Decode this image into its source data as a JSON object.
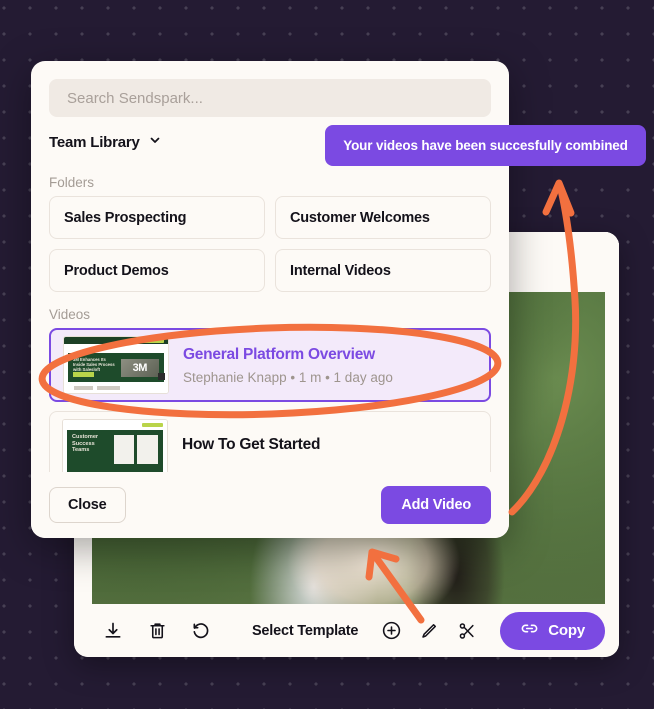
{
  "theme": {
    "background": "#241B33",
    "panel": "#FDFAF6",
    "accent_purple": "#7B4AE2",
    "selected_row_bg": "#F3EAFA",
    "annotation_orange": "#F2703F",
    "muted_text": "#A49C95",
    "primary_text": "#14121A"
  },
  "toast": {
    "message": "Your videos have been succesfully combined"
  },
  "modal": {
    "search": {
      "placeholder": "Search Sendspark...",
      "value": ""
    },
    "library_selector": {
      "label": "Team Library",
      "icon": "chevron-down-icon"
    },
    "folders_label": "Folders",
    "folders": [
      {
        "label": "Sales Prospecting"
      },
      {
        "label": "Customer Welcomes"
      },
      {
        "label": "Product Demos"
      },
      {
        "label": "Internal Videos"
      }
    ],
    "videos_label": "Videos",
    "videos": [
      {
        "title": "General Platform Overview",
        "meta": "Stephanie Knapp • 1 m • 1 day ago",
        "author": "Stephanie Knapp",
        "duration": "1 m",
        "age": "1 day ago",
        "selected": true,
        "thumbnail": {
          "headline": "3M Enhances Its Inside Sales Process with Salesloft",
          "badge": "3M"
        }
      },
      {
        "title": "How To Get Started",
        "meta": "",
        "selected": false,
        "thumbnail": {
          "headline": "Customer Success Teams",
          "badge": ""
        }
      }
    ],
    "footer": {
      "close_label": "Close",
      "add_video_label": "Add Video"
    }
  },
  "player": {
    "toolbar": {
      "left_icons": [
        {
          "name": "download-icon"
        },
        {
          "name": "trash-icon"
        },
        {
          "name": "undo-icon"
        }
      ],
      "select_template_label": "Select Template",
      "right_icons": [
        {
          "name": "plus-circle-icon"
        },
        {
          "name": "pencil-icon"
        },
        {
          "name": "scissors-icon"
        }
      ],
      "copy_label": "Copy",
      "copy_icon": "link-icon"
    }
  },
  "annotations": [
    {
      "type": "ellipse",
      "target": "selected video row"
    },
    {
      "type": "arrow",
      "target": "toast notification"
    },
    {
      "type": "arrow",
      "target": "video preview area"
    }
  ]
}
